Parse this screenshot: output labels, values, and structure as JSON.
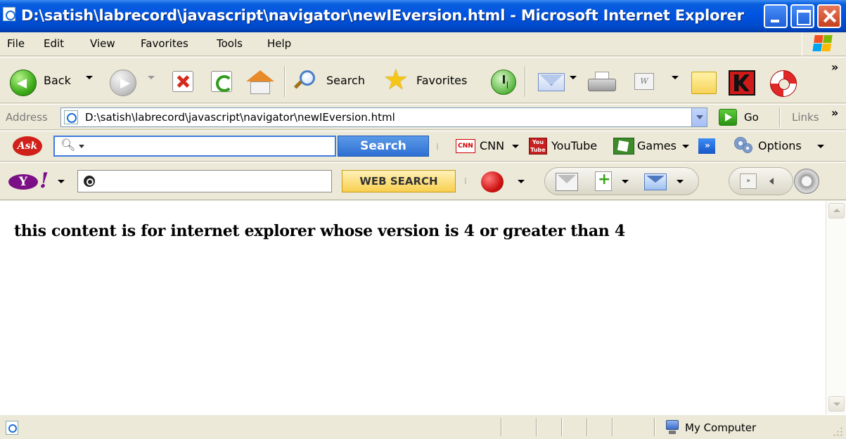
{
  "window": {
    "title": "D:\\satish\\labrecord\\javascript\\navigator\\newIEversion.html - Microsoft Internet Explorer"
  },
  "menubar": {
    "items": [
      "File",
      "Edit",
      "View",
      "Favorites",
      "Tools",
      "Help"
    ]
  },
  "toolbar": {
    "back_label": "Back",
    "search_label": "Search",
    "favorites_label": "Favorites",
    "overflow_label": "»"
  },
  "addressbar": {
    "label": "Address",
    "value": "D:\\satish\\labrecord\\javascript\\navigator\\newIEversion.html",
    "go_label": "Go",
    "links_label": "Links",
    "overflow_label": "»"
  },
  "ask_toolbar": {
    "logo_text": "Ask",
    "search_input_value": "",
    "search_button_label": "Search",
    "cnn_label": "CNN",
    "cnn_icon_text": "CNN",
    "youtube_label": "YouTube",
    "youtube_icon_text": "You Tube",
    "games_label": "Games",
    "more_label": "»",
    "options_label": "Options"
  },
  "yahoo_toolbar": {
    "logo_y": "Y",
    "logo_bang": "!",
    "search_input_value": "",
    "web_search_label": "WEB SEARCH",
    "more_label": "»"
  },
  "content": {
    "heading": "this content is for internet explorer whose version is 4 or greater than 4"
  },
  "statusbar": {
    "status_text": "",
    "zone_label": "My Computer"
  },
  "icons": {
    "word_icon_text": "W"
  }
}
